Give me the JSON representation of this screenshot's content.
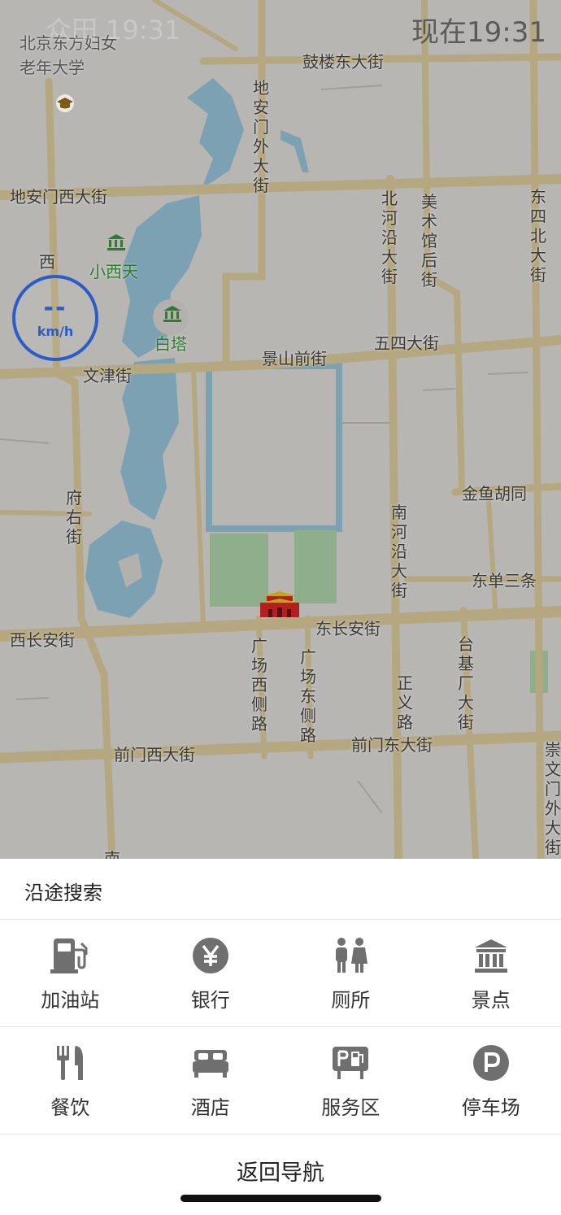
{
  "status": {
    "time": "现在19:31",
    "faded": "众田 19:31"
  },
  "speed": {
    "value": "--",
    "unit": "km/h"
  },
  "map": {
    "labels": {
      "beijing_univ": "北京东方妇女老年大学",
      "gulou_east": "鼓楼东大街",
      "dianmen_north": "地安门外大街",
      "dianmen_west": "地安门西大街",
      "beihe_yan": "北河沿大街",
      "meishuguan": "美术馆后街",
      "dongsi_north": "东四北大街",
      "xi": "西",
      "xiaoxitian": "小西天",
      "baita": "白塔",
      "jingshan": "景山前街",
      "wusi": "五四大街",
      "wenjin": "文津街",
      "fuyou": "府右街",
      "nanhe_yan": "南河沿大街",
      "jinyu": "金鱼胡同",
      "dongdan": "东单三条",
      "xichangan": "西长安街",
      "dongchangan": "东长安街",
      "guangchang_west": "广场西侧路",
      "guangchang_east": "广场东侧路",
      "zhengyi": "正义路",
      "taiji": "台基厂大街",
      "qianmen_west": "前门西大街",
      "qianmen_east": "前门东大街",
      "chongwen": "崇文门外大街",
      "nan": "南"
    }
  },
  "panel": {
    "title": "沿途搜索",
    "categories_row1": [
      {
        "label": "加油站",
        "icon": "gas-station-icon"
      },
      {
        "label": "银行",
        "icon": "bank-yen-icon"
      },
      {
        "label": "厕所",
        "icon": "toilet-icon"
      },
      {
        "label": "景点",
        "icon": "landmark-icon"
      }
    ],
    "categories_row2": [
      {
        "label": "餐饮",
        "icon": "dining-icon"
      },
      {
        "label": "酒店",
        "icon": "hotel-bed-icon"
      },
      {
        "label": "服务区",
        "icon": "service-area-icon"
      },
      {
        "label": "停车场",
        "icon": "parking-icon"
      }
    ],
    "back_label": "返回导航"
  },
  "colors": {
    "accent": "#2c5cc8",
    "road": "#e8d6a5",
    "water": "#9fcfe5",
    "park": "#b6dfb4",
    "icon_gray": "#6f6f6f"
  }
}
